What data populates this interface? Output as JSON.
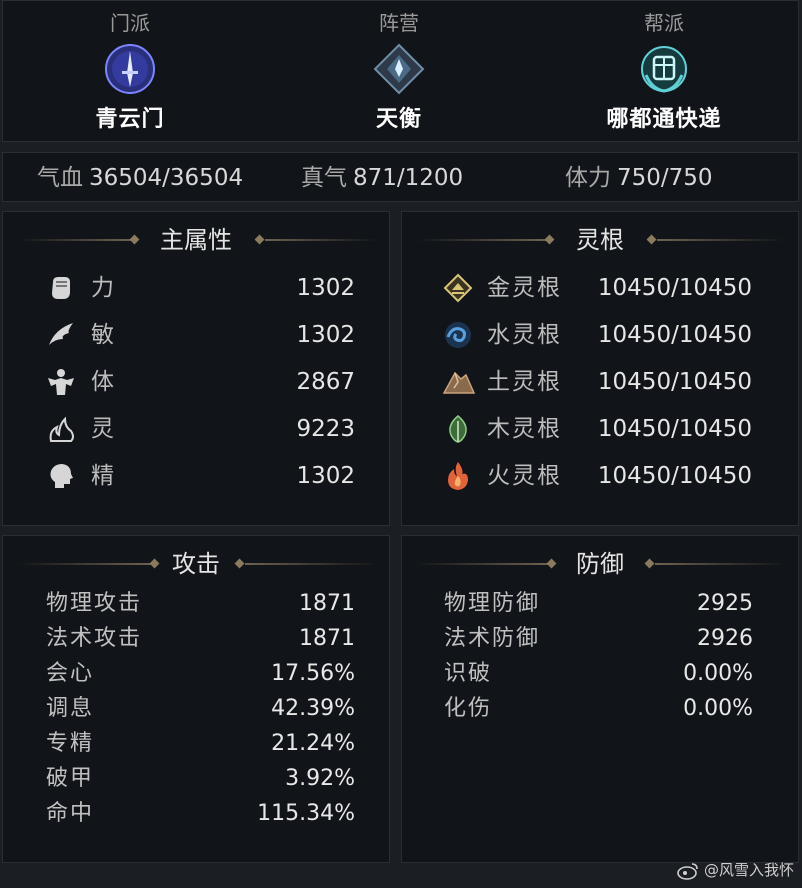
{
  "factions": [
    {
      "label": "门派",
      "value": "青云门",
      "icon": "sect-sword-emblem-icon"
    },
    {
      "label": "阵营",
      "value": "天衡",
      "icon": "camp-emblem-icon"
    },
    {
      "label": "帮派",
      "value": "哪都通快递",
      "icon": "guild-tong-emblem-icon"
    }
  ],
  "vitals": [
    {
      "label": "气血",
      "value": "36504/36504"
    },
    {
      "label": "真气",
      "value": "871/1200"
    },
    {
      "label": "体力",
      "value": "750/750"
    }
  ],
  "main_attributes": {
    "title": "主属性",
    "items": [
      {
        "label": "力",
        "value": "1302",
        "icon": "fist-icon"
      },
      {
        "label": "敏",
        "value": "1302",
        "icon": "wing-icon"
      },
      {
        "label": "体",
        "value": "2867",
        "icon": "body-icon"
      },
      {
        "label": "灵",
        "value": "9223",
        "icon": "flame-spirit-icon"
      },
      {
        "label": "精",
        "value": "1302",
        "icon": "head-icon"
      }
    ]
  },
  "spirit_roots": {
    "title": "灵根",
    "items": [
      {
        "label": "金灵根",
        "value": "10450/10450",
        "icon": "metal-root-icon",
        "color": "#d9c47a"
      },
      {
        "label": "水灵根",
        "value": "10450/10450",
        "icon": "water-root-icon",
        "color": "#5aa0e0"
      },
      {
        "label": "土灵根",
        "value": "10450/10450",
        "icon": "earth-root-icon",
        "color": "#b8906a"
      },
      {
        "label": "木灵根",
        "value": "10450/10450",
        "icon": "wood-root-icon",
        "color": "#8fcf8a"
      },
      {
        "label": "火灵根",
        "value": "10450/10450",
        "icon": "fire-root-icon",
        "color": "#e2623a"
      }
    ]
  },
  "attack": {
    "title": "攻击",
    "items": [
      {
        "label": "物理攻击",
        "value": "1871"
      },
      {
        "label": "法术攻击",
        "value": "1871"
      },
      {
        "label": "会心",
        "value": "17.56%"
      },
      {
        "label": "调息",
        "value": "42.39%"
      },
      {
        "label": "专精",
        "value": "21.24%"
      },
      {
        "label": "破甲",
        "value": "3.92%"
      },
      {
        "label": "命中",
        "value": "115.34%"
      }
    ]
  },
  "defense": {
    "title": "防御",
    "items": [
      {
        "label": "物理防御",
        "value": "2925"
      },
      {
        "label": "法术防御",
        "value": "2926"
      },
      {
        "label": "识破",
        "value": "0.00%"
      },
      {
        "label": "化伤",
        "value": "0.00%"
      }
    ]
  },
  "watermark": {
    "text": "@风雪入我怀",
    "icon": "weibo-icon"
  }
}
